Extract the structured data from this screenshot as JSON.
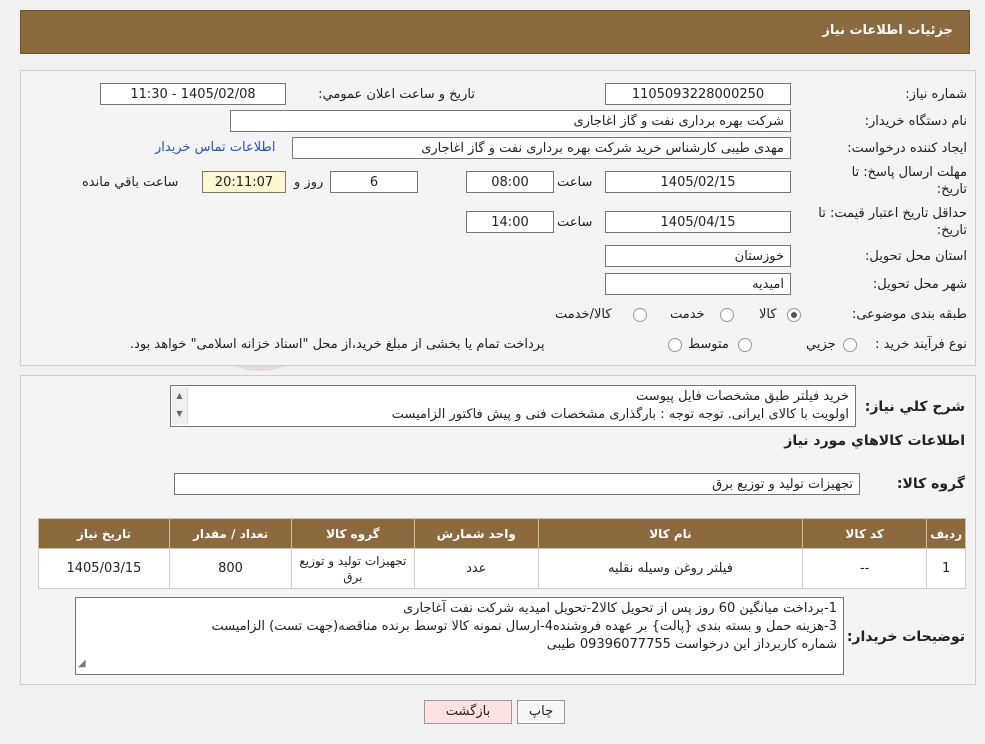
{
  "header": {
    "title": "جزئیات اطلاعات نیاز"
  },
  "watermark": {
    "text": "AriaTender.neT"
  },
  "form": {
    "need_number_label": "شماره نیاز:",
    "need_number": "1105093228000250",
    "announce_label": "تاریخ و ساعت اعلان عمومي:",
    "announce_value": "1405/02/08 - 11:30",
    "buyer_org_label": "نام دستگاه خريدار:",
    "buyer_org": "شرکت بهره برداری نفت و گاز اغاجاری",
    "requester_label": "ايجاد کننده درخواست:",
    "requester": "مهدی طیبی کارشناس خرید شرکت بهره برداری نفت و گاز اغاجاری",
    "contact_link": "اطلاعات تماس خريدار",
    "deadline_label_1": "مهلت ارسال پاسخ: تا",
    "deadline_label_2": "تاريخ:",
    "deadline_date": "1405/02/15",
    "time_label": "ساعت",
    "deadline_time": "08:00",
    "days_value": "6",
    "days_label": "روز و",
    "remaining_time": "20:11:07",
    "remaining_label": "ساعت باقي مانده",
    "validity_label_1": "حداقل تاريخ اعتبار قيمت: تا",
    "validity_label_2": "تاريخ:",
    "validity_date": "1405/04/15",
    "validity_time": "14:00",
    "province_label": "استان محل تحويل:",
    "province": "خوزستان",
    "city_label": "شهر محل تحويل:",
    "city": "امیدیه",
    "category_label": "طبقه بندی موضوعی:",
    "category_options": [
      "کالا",
      "خدمت",
      "کالا/خدمت"
    ],
    "category_selected": "کالا",
    "process_label": "نوع فرآيند خريد :",
    "process_options": [
      "جزيي",
      "متوسط"
    ],
    "process_note": "پرداخت تمام يا بخشی از مبلغ خريد،از محل \"اسناد خزانه اسلامی\" خواهد بود."
  },
  "description": {
    "label": "شرح کلي نياز:",
    "lines": [
      "خرید فیلتر طبق مشخصات فایل پیوست",
      "اولویت با کالای ایرانی. توجه توجه : بارگذاری مشخصات فنی و پیش فاکتور الزامیست"
    ]
  },
  "goods": {
    "section_title": "اطلاعات کالاهاي مورد نياز",
    "group_label": "گروه کالا:",
    "group_value": "تجهیزات تولید و توزیع برق",
    "columns": [
      "رديف",
      "کد کالا",
      "نام کالا",
      "واحد شمارش",
      "گروه کالا",
      "تعداد / مقدار",
      "تاريخ نياز"
    ],
    "rows": [
      [
        "1",
        "--",
        "فیلتر روغن وسیله نقلیه",
        "عدد",
        "تجهیزات تولید و توزیع برق",
        "800",
        "1405/03/15"
      ]
    ]
  },
  "buyer_notes": {
    "label": "توضيحات خريدار:",
    "lines": [
      "1-برداخت میانگین 60 روز پس از تحویل کالا2-تحویل امیدیه شرکت نفت آغاجاری",
      "3-هزینه حمل  و بسته بندی {پالت} بر عهده فروشنده4-ارسال نمونه کالا توسط برنده مناقصه(جهت تست) الزامیست",
      "شماره کاربرداز این درخواست 09396077755 طیبی"
    ]
  },
  "buttons": {
    "print": "چاپ",
    "back": "بازگشت"
  }
}
